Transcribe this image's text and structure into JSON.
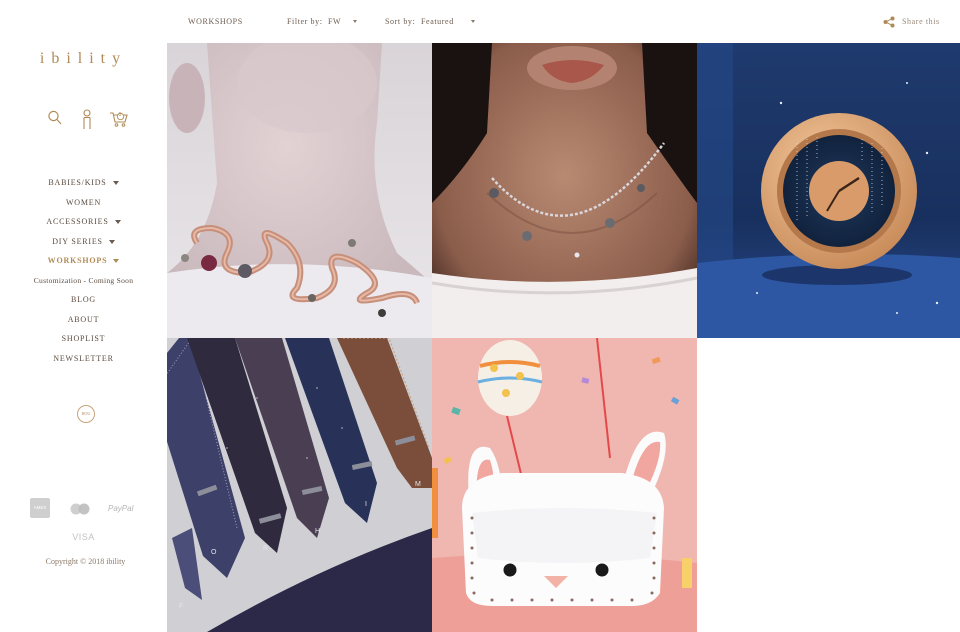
{
  "brand": {
    "logo_text": "ibility"
  },
  "header_icons": [
    "search-icon",
    "user-icon",
    "cart-icon"
  ],
  "cart": {
    "count": "0"
  },
  "nav": {
    "items": [
      {
        "label": "BABIES/KIDS",
        "has_caret": true
      },
      {
        "label": "WOMEN",
        "has_caret": false
      },
      {
        "label": "ACCESSORIES",
        "has_caret": true
      },
      {
        "label": "DIY SERIES",
        "has_caret": true
      },
      {
        "label": "WORKSHOPS",
        "has_caret": true,
        "active": true
      },
      {
        "label": "Customization - Coming Soon",
        "has_caret": false
      },
      {
        "label": "BLOG",
        "has_caret": false
      },
      {
        "label": "ABOUT",
        "has_caret": false
      },
      {
        "label": "SHOPLIST",
        "has_caret": false
      },
      {
        "label": "NEWSLETTER",
        "has_caret": false
      }
    ]
  },
  "social_badge": {
    "label": "HOU"
  },
  "payments": {
    "amex": "AMEX",
    "mastercard": "MC",
    "paypal": "PayPal",
    "visa": "VISA"
  },
  "footer": {
    "copyright": "Copyright © 2018 ibility"
  },
  "topbar": {
    "section_title": "WORKSHOPS",
    "filter_label": "Filter by:",
    "filter_value": "FW",
    "sort_label": "Sort by:",
    "sort_value": "Featured",
    "share_label": "Share this"
  },
  "products": [
    {
      "name": "rose-gold-wire-necklace",
      "image": "necklace on pale neck"
    },
    {
      "name": "crystal-bead-necklace",
      "image": "beaded necklace on model"
    },
    {
      "name": "wooden-clock",
      "image": "round wooden clock on blue"
    },
    {
      "name": "monogram-ties",
      "image": "patterned neckties with letters"
    },
    {
      "name": "bunny-bag-workshop",
      "image": "white bunny leather bag"
    }
  ],
  "colors": {
    "accent": "#b08a56",
    "nav_text": "#5a4a3e",
    "active": "#b08a56"
  }
}
